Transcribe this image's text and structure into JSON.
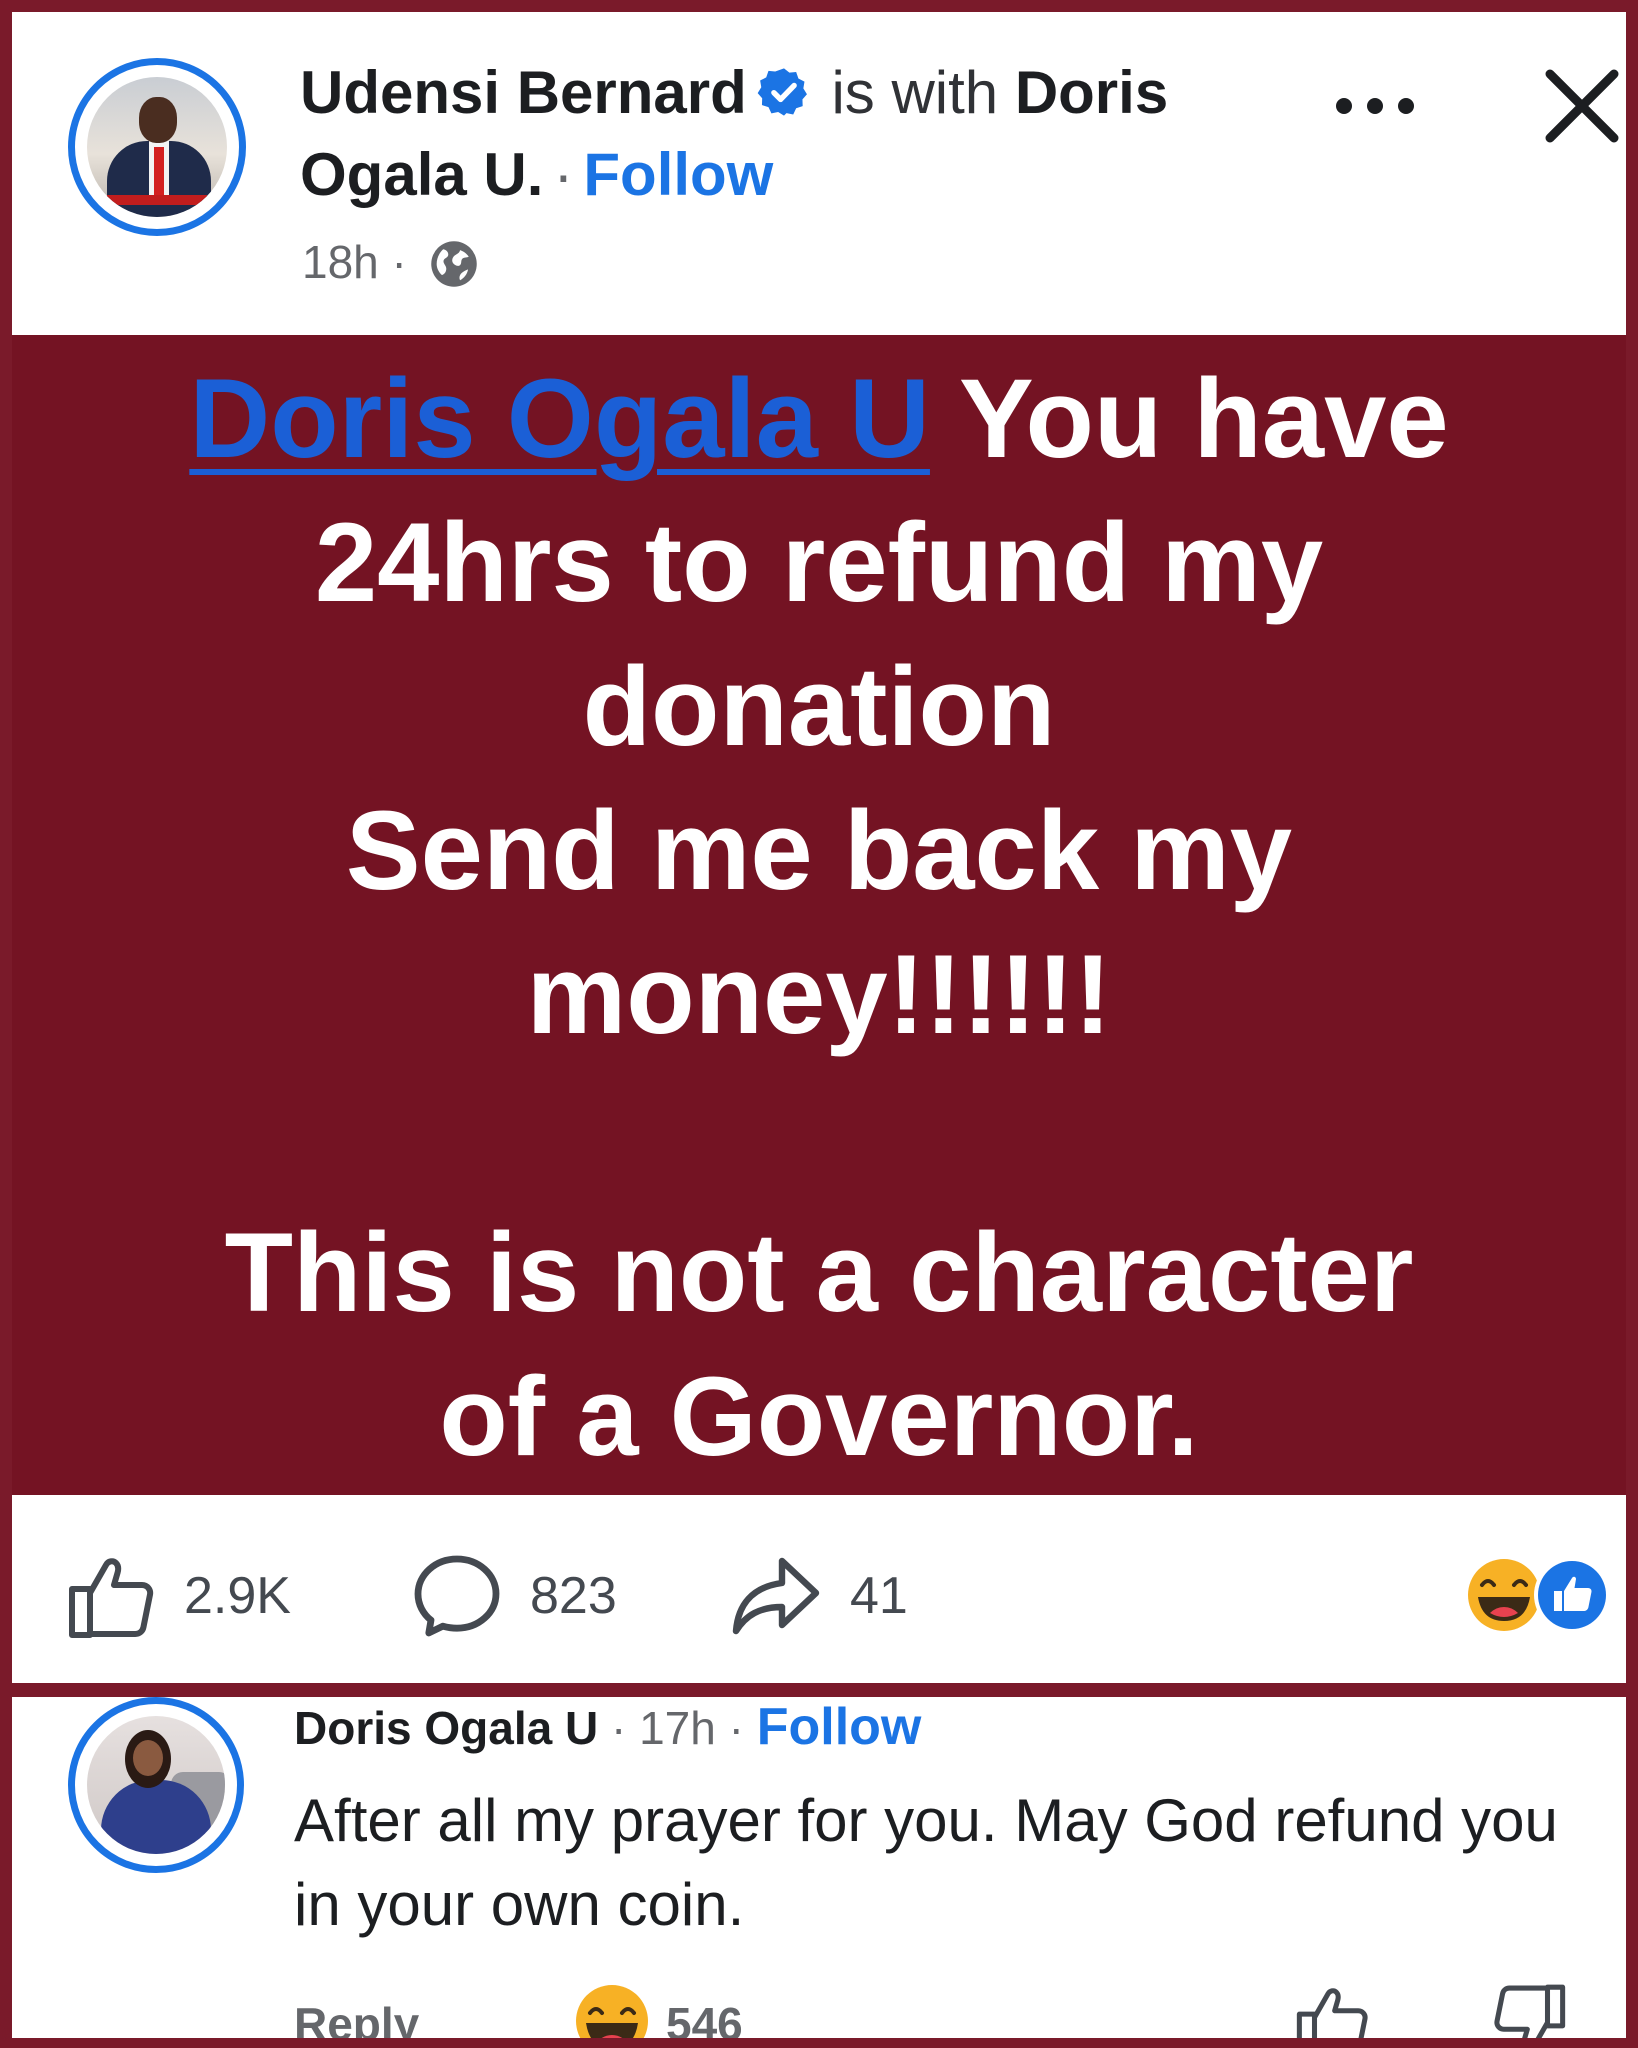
{
  "post": {
    "author": "Udensi Bernard",
    "with_text": "is with",
    "tagged_first": "Doris",
    "tagged_rest": "Ogala U.",
    "follow_label": "Follow",
    "time": "18h",
    "separator": "·"
  },
  "banner": {
    "mention": "Doris Ogala U",
    "line1_rest": " You have",
    "line2": "24hrs to refund my",
    "line3": "donation",
    "line4": "Send me back my",
    "line5": "money!!!!!!",
    "line6": "This is not a character",
    "line7": "of a Governor.",
    "background": "#741323"
  },
  "actions": {
    "likes": "2.9K",
    "comments": "823",
    "shares": "41"
  },
  "comment": {
    "author": "Doris Ogala U",
    "time": "17h",
    "follow_label": "Follow",
    "text": "After all my prayer for you. May God refund you in your own coin.",
    "reply_label": "Reply",
    "reaction_count": "546"
  },
  "colors": {
    "accent": "#1b74e4",
    "frame": "#7a1a2a"
  },
  "icons": [
    "verified-icon",
    "globe-icon",
    "more-icon",
    "close-icon",
    "like-icon",
    "comment-icon",
    "share-icon",
    "haha-reaction-icon",
    "like-reaction-icon",
    "dislike-icon"
  ]
}
